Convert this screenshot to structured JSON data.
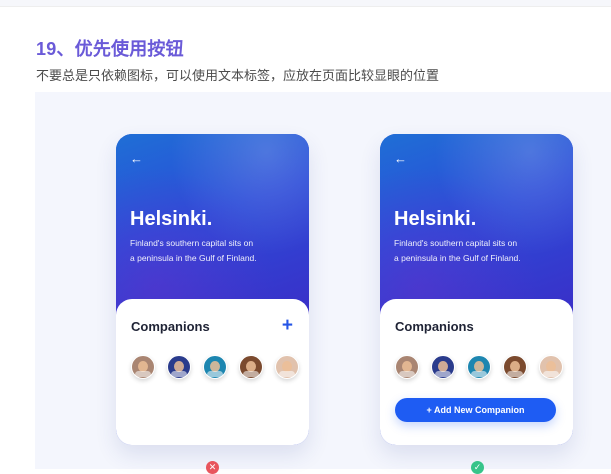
{
  "header": {
    "title": "19、优先使用按钮",
    "subtitle": "不要总是只依赖图标，可以使用文本标签，应放在页面比较显眼的位置"
  },
  "cards": [
    {
      "back_icon": "←",
      "city": "Helsinki.",
      "desc_line1": "Finland's southern capital sits on",
      "desc_line2": "a peninsula in the Gulf of Finland.",
      "section_title": "Companions",
      "plus_icon": "+",
      "avatar_colors": [
        "#a98572",
        "#2a3b8c",
        "#1d86b0",
        "#7b4a2e",
        "#e1c2ad"
      ]
    },
    {
      "back_icon": "←",
      "city": "Helsinki.",
      "desc_line1": "Finland's southern capital sits on",
      "desc_line2": "a peninsula in the Gulf of Finland.",
      "section_title": "Companions",
      "button_label": "+ Add New Companion",
      "avatar_colors": [
        "#a98572",
        "#2a3b8c",
        "#1d86b0",
        "#7b4a2e",
        "#e1c2ad"
      ]
    }
  ],
  "verdicts": {
    "bad_color": "#e8555d",
    "bad_symbol": "✕",
    "good_color": "#37c48a",
    "good_symbol": "✓"
  }
}
